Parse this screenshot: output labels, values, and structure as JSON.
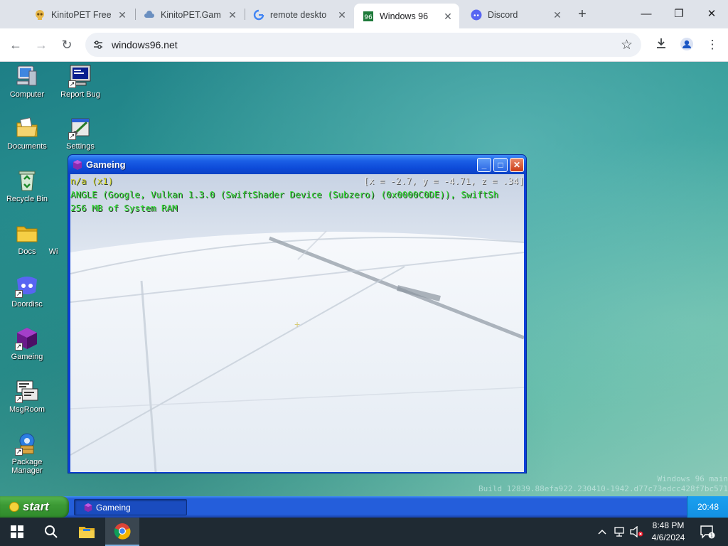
{
  "browser": {
    "tabs": [
      {
        "title": "KinitoPET Free",
        "icon": "skull-icon",
        "active": false
      },
      {
        "title": "KinitoPET.Gam",
        "icon": "cloud-icon",
        "active": false
      },
      {
        "title": "remote deskto",
        "icon": "google-icon",
        "active": false
      },
      {
        "title": "Windows 96",
        "icon": "windows96-icon",
        "active": true
      },
      {
        "title": "Discord",
        "icon": "discord-icon",
        "active": false
      }
    ],
    "url": "windows96.net"
  },
  "desktop": {
    "icons": [
      {
        "label": "Computer",
        "icon": "computer-icon"
      },
      {
        "label": "Report Bug",
        "icon": "report-bug-icon"
      },
      {
        "label": "Documents",
        "icon": "documents-folder-icon"
      },
      {
        "label": "Settings",
        "icon": "settings-icon"
      },
      {
        "label": "Recycle Bin",
        "icon": "recycle-bin-icon"
      },
      {
        "label": "Docs",
        "icon": "folder-icon"
      },
      {
        "label": "Wi",
        "icon": "hidden-icon"
      },
      {
        "label": "Doordisc",
        "icon": "doordisc-icon"
      },
      {
        "label": "Gameing",
        "icon": "gameing-cube-icon"
      },
      {
        "label": "MsgRoom",
        "icon": "msgroom-icon"
      },
      {
        "label": "Package Manager",
        "icon": "package-manager-icon"
      }
    ],
    "watermark": {
      "line1": "Windows 96 main",
      "line2": "Build 12839.88efa922.230410-1942.d77c73edcc428f7bc571"
    }
  },
  "window": {
    "title": "Gameing",
    "hud": {
      "line1": "n/a (x1)",
      "coords": "[x = -2.7, y = -4.71, z = .34]",
      "line2": "ANGLE (Google, Vulkan 1.3.0 (SwiftShader Device (Subzero) (0x0000C0DE)), SwiftSh",
      "line3": "256 MB of System RAM"
    },
    "crosshair": "+"
  },
  "w96taskbar": {
    "start_label": "start",
    "task_label": "Gameing",
    "clock": "20:48"
  },
  "win10taskbar": {
    "time": "8:48 PM",
    "date": "4/6/2024",
    "notification_count": "1"
  },
  "colors": {
    "hud_yellow": "#d5d522",
    "hud_green": "#36e33a",
    "xp_blue": "#245edb",
    "start_green": "#3c9a35"
  }
}
